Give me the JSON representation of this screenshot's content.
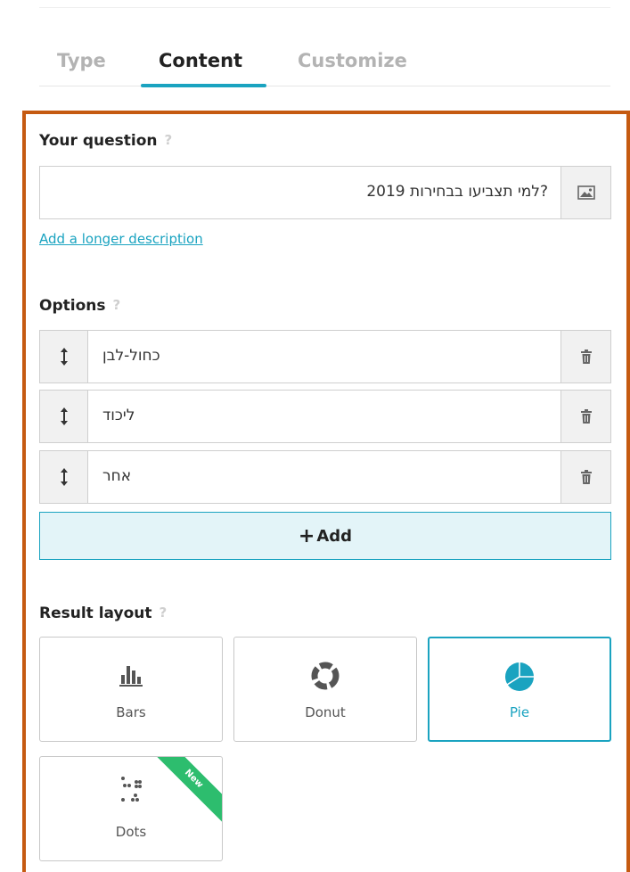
{
  "tabs": [
    {
      "label": "Type"
    },
    {
      "label": "Content"
    },
    {
      "label": "Customize"
    }
  ],
  "question": {
    "label": "Your question",
    "help": "?",
    "value": "?למי תצביעו בבחירות 2019",
    "description_link": "Add a longer description"
  },
  "options": {
    "label": "Options",
    "help": "?",
    "items": [
      {
        "value": "כחול-לבן"
      },
      {
        "value": "ליכוד"
      },
      {
        "value": "אחר"
      }
    ],
    "add_label": "Add"
  },
  "result_layout": {
    "label": "Result layout",
    "help": "?",
    "cards": [
      {
        "label": "Bars",
        "icon": "bar-chart-icon"
      },
      {
        "label": "Donut",
        "icon": "donut-chart-icon"
      },
      {
        "label": "Pie",
        "icon": "pie-chart-icon",
        "selected": true
      },
      {
        "label": "Dots",
        "icon": "dots-chart-icon",
        "badge": "New"
      }
    ]
  },
  "colors": {
    "accent": "#1aa3c0",
    "frame": "#c55a11",
    "new_badge": "#2dbd6e"
  }
}
